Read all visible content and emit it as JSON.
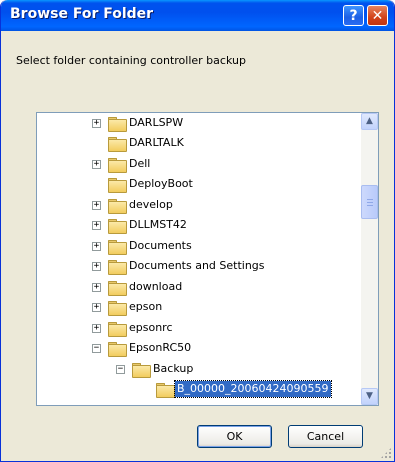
{
  "window": {
    "title": "Browse For Folder",
    "help_label": "?",
    "close_label": "✕"
  },
  "prompt": "Select folder containing controller backup",
  "tree": {
    "items": [
      {
        "label": "DARLSPW",
        "expander": "+",
        "selected": false
      },
      {
        "label": "DARLTALK",
        "expander": "",
        "selected": false
      },
      {
        "label": "Dell",
        "expander": "+",
        "selected": false
      },
      {
        "label": "DeployBoot",
        "expander": "",
        "selected": false
      },
      {
        "label": "develop",
        "expander": "+",
        "selected": false
      },
      {
        "label": "DLLMST42",
        "expander": "+",
        "selected": false
      },
      {
        "label": "Documents",
        "expander": "+",
        "selected": false
      },
      {
        "label": "Documents and Settings",
        "expander": "+",
        "selected": false
      },
      {
        "label": "download",
        "expander": "+",
        "selected": false
      },
      {
        "label": "epson",
        "expander": "+",
        "selected": false
      },
      {
        "label": "epsonrc",
        "expander": "+",
        "selected": false
      },
      {
        "label": "EpsonRC50",
        "expander": "−",
        "selected": false
      },
      {
        "label": "Backup",
        "expander": "−",
        "selected": false
      },
      {
        "label": "B_00000_20060424090559",
        "expander": "",
        "selected": true
      }
    ],
    "scroll_up_glyph": "▲",
    "scroll_down_glyph": "▼"
  },
  "buttons": {
    "ok": "OK",
    "cancel": "Cancel"
  },
  "colors": {
    "titlebar": "#0054e3",
    "dialog_bg": "#ece9d8",
    "selection": "#316ac5",
    "close_button": "#d2431b"
  }
}
